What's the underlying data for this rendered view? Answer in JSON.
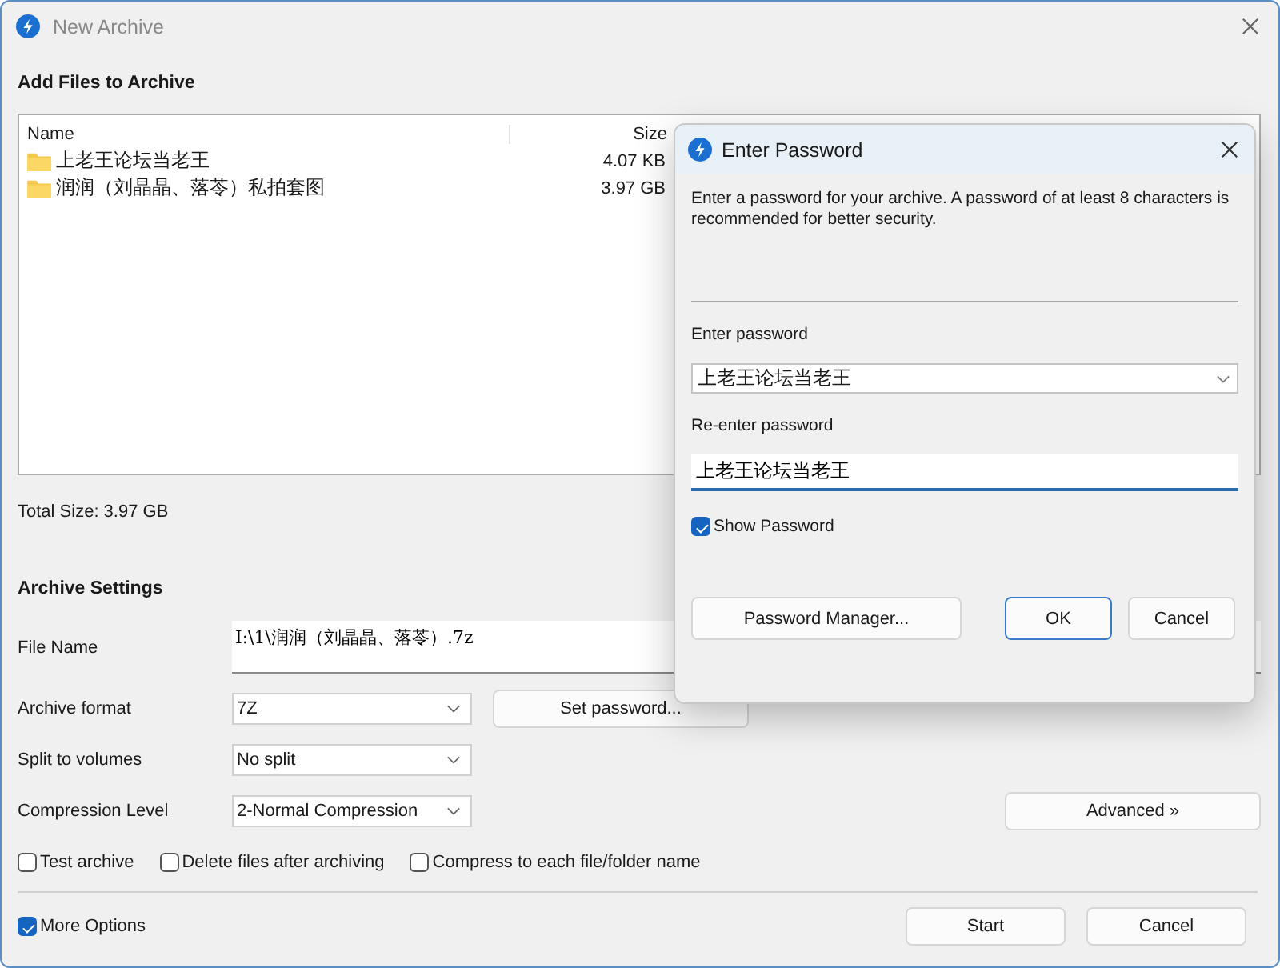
{
  "window": {
    "title": "New Archive"
  },
  "files_section": {
    "heading": "Add Files to Archive",
    "columns": [
      "Name",
      "Size"
    ],
    "rows": [
      {
        "name": "上老王论坛当老王",
        "size": "4.07 KB"
      },
      {
        "name": "润润（刘晶晶、落苓）私拍套图",
        "size": "3.97 GB"
      }
    ],
    "total": "Total Size: 3.97 GB"
  },
  "settings": {
    "heading": "Archive Settings",
    "file_name": {
      "label": "File Name",
      "value": "I:\\1\\润润（刘晶晶、落苓）.7z"
    },
    "archive_format": {
      "label": "Archive format",
      "value": "7Z"
    },
    "set_password_button": "Set password...",
    "split": {
      "label": "Split to volumes",
      "value": "No split"
    },
    "compression": {
      "label": "Compression Level",
      "value": "2-Normal Compression"
    },
    "advanced_button": "Advanced »",
    "options": [
      {
        "label": "Test archive",
        "checked": false
      },
      {
        "label": "Delete files after archiving",
        "checked": false
      },
      {
        "label": "Compress to each file/folder name",
        "checked": false
      }
    ]
  },
  "footer": {
    "more_options": {
      "label": "More Options",
      "checked": true
    },
    "buttons": [
      "Start",
      "Cancel"
    ]
  },
  "password_dialog": {
    "title": "Enter Password",
    "message": "Enter a password for your archive. A password of at least 8 characters is recommended for better security.",
    "enter_label": "Enter password",
    "enter_value": "上老王论坛当老王",
    "reenter_label": "Re-enter password",
    "reenter_value": "上老王论坛当老王",
    "show_password": {
      "label": "Show Password",
      "checked": true
    },
    "buttons": [
      {
        "label": "Password Manager...",
        "kind": "wide"
      },
      {
        "label": "OK",
        "kind": "default"
      },
      {
        "label": "Cancel",
        "kind": "normal"
      }
    ]
  }
}
